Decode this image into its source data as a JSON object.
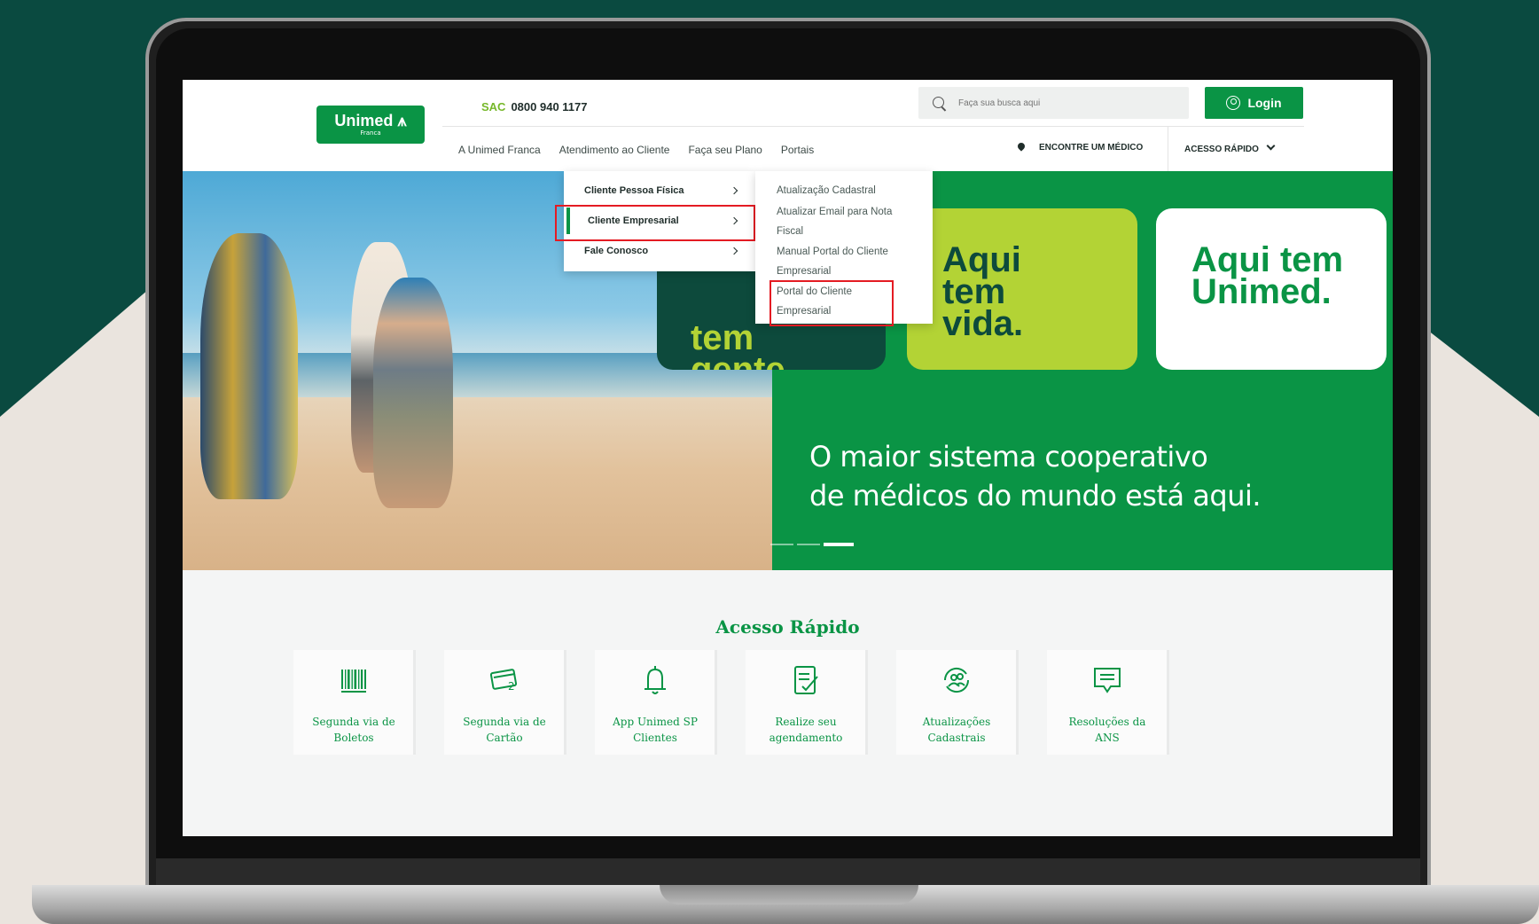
{
  "header": {
    "logo": {
      "name": "Unimed",
      "sub": "Franca"
    },
    "sac": {
      "label": "SAC",
      "phone": "0800 940 1177"
    },
    "search": {
      "placeholder": "Faça sua busca aqui"
    },
    "login_label": "Login",
    "nav": [
      "A Unimed Franca",
      "Atendimento ao Cliente",
      "Faça seu Plano",
      "Portais"
    ],
    "find_doctor": "ENCONTRE UM MÉDICO",
    "quick_access": "ACESSO RÁPIDO"
  },
  "dropdown": {
    "items": [
      "Cliente Pessoa Física",
      "Cliente Empresarial",
      "Fale Conosco"
    ],
    "active_index": 1,
    "submenu": [
      "Atualização Cadastral",
      "Atualizar Email para Nota Fiscal",
      "Manual Portal do Cliente Empresarial",
      "Portal do Cliente Empresarial"
    ]
  },
  "hero": {
    "card1": "tem gente.",
    "card2": "Aqui tem vida.",
    "card3": "Aqui tem Unimed.",
    "headline_line1": "O maior sistema cooperativo",
    "headline_line2": "de médicos do mundo está aqui."
  },
  "quick_access_section": {
    "title": "Acesso Rápido",
    "items": [
      {
        "label_l1": "Segunda via de",
        "label_l2": "Boletos",
        "icon": "barcode-icon"
      },
      {
        "label_l1": "Segunda via de",
        "label_l2": "Cartão",
        "icon": "card-icon"
      },
      {
        "label_l1": "App Unimed SP",
        "label_l2": "Clientes",
        "icon": "bell-icon"
      },
      {
        "label_l1": "Realize seu",
        "label_l2": "agendamento",
        "icon": "checklist-icon"
      },
      {
        "label_l1": "Atualizações",
        "label_l2": "Cadastrais",
        "icon": "users-refresh-icon"
      },
      {
        "label_l1": "Resoluções da",
        "label_l2": "ANS",
        "icon": "chat-document-icon"
      }
    ]
  },
  "colors": {
    "primary_green": "#0a9445",
    "dark_green": "#0d4a3c",
    "lime": "#b3d335",
    "highlight_red": "#e41b23",
    "background_teal": "#0a4a40"
  }
}
